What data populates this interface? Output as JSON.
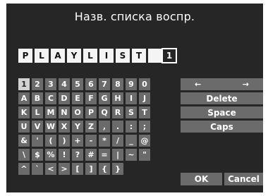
{
  "title": "Назв. списка воспр.",
  "name_chars": [
    "P",
    "L",
    "A",
    "Y",
    "L",
    "I",
    "S",
    "T",
    "",
    ""
  ],
  "char_count": "1",
  "keys": [
    [
      "1",
      "2",
      "3",
      "4",
      "5",
      "6",
      "7",
      "8",
      "9",
      "0"
    ],
    [
      "A",
      "B",
      "C",
      "D",
      "E",
      "F",
      "G",
      "H",
      "I",
      "J"
    ],
    [
      "K",
      "L",
      "M",
      "N",
      "O",
      "P",
      "Q",
      "R",
      "S",
      "T"
    ],
    [
      "U",
      "V",
      "W",
      "X",
      "Y",
      "Z",
      ",",
      ".",
      ":",
      ";"
    ],
    [
      "&",
      "'",
      "(",
      ")",
      "+",
      "-",
      "*",
      "/",
      "_",
      "@"
    ],
    [
      "\\",
      "$",
      "%",
      "!",
      "?",
      "#",
      "=",
      "|",
      "~",
      "\""
    ],
    [
      "^",
      "`",
      "<",
      ">",
      "[",
      "]",
      "{",
      "}"
    ]
  ],
  "selected_key": "1",
  "cursor": {
    "left": "←",
    "right": "→"
  },
  "actions": {
    "delete": "Delete",
    "space": "Space",
    "caps": "Caps",
    "ok": "OK",
    "cancel": "Cancel"
  }
}
